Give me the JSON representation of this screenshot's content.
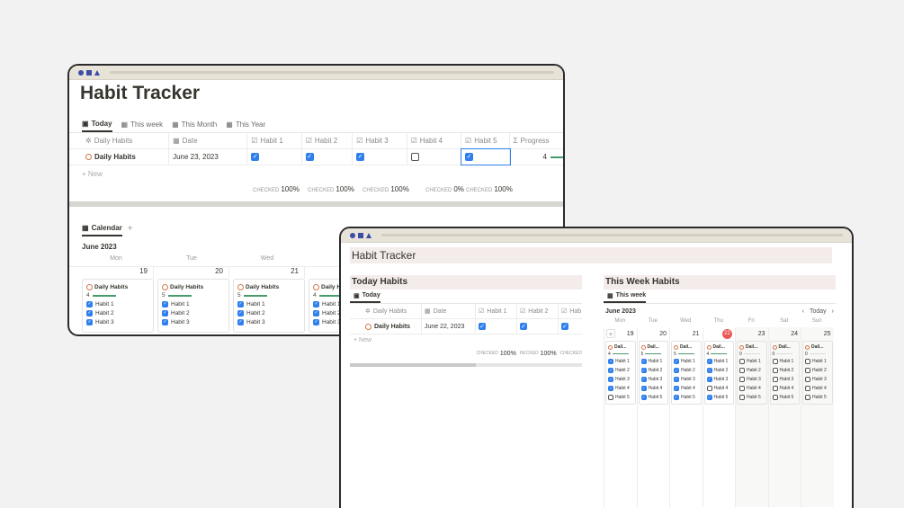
{
  "back": {
    "title": "Habit Tracker",
    "tabs": [
      "Today",
      "This week",
      "This Month",
      "This Year"
    ],
    "columns": [
      "Daily Habits",
      "Date",
      "Habit 1",
      "Habit 2",
      "Habit 3",
      "Habit 4",
      "Habit 5",
      "Progress"
    ],
    "row": {
      "name": "Daily Habits",
      "date": "June 23, 2023",
      "checks": [
        true,
        true,
        true,
        false,
        true
      ],
      "progress": "4"
    },
    "new_label": "+ New",
    "calc": [
      {
        "label": "CHECKED",
        "value": "100%"
      },
      {
        "label": "CHECKED",
        "value": "100%"
      },
      {
        "label": "CHECKED",
        "value": "100%"
      },
      {
        "label": "CHECKED",
        "value": "0%"
      },
      {
        "label": "CHECKED",
        "value": "100%"
      }
    ],
    "calendar": {
      "tab": "Calendar",
      "add": "+",
      "month": "June 2023",
      "dows": [
        "Mon",
        "Tue",
        "Wed"
      ],
      "days": [
        "19",
        "20",
        "21"
      ],
      "cards": [
        {
          "title": "Daily Habits",
          "progress": "4",
          "habits": [
            "Habit 1",
            "Habit 2",
            "Habit 3"
          ]
        },
        {
          "title": "Daily Habits",
          "progress": "5",
          "habits": [
            "Habit 1",
            "Habit 2",
            "Habit 3"
          ]
        },
        {
          "title": "Daily Habits",
          "progress": "5",
          "habits": [
            "Habit 1",
            "Habit 2",
            "Habit 3"
          ]
        },
        {
          "title": "Daily Habits",
          "progress": "4",
          "habits": [
            "Habit 1",
            "Habit 2",
            "Habit 3"
          ]
        }
      ]
    }
  },
  "front": {
    "title": "Habit Tracker",
    "today": {
      "title": "Today Habits",
      "tab": "Today",
      "columns": [
        "Daily Habits",
        "Date",
        "Habit 1",
        "Habit 2",
        "Hab"
      ],
      "row": {
        "name": "Daily Habits",
        "date": "June 22, 2023"
      },
      "new_label": "+ New",
      "calc": [
        {
          "label": "CHECKED",
          "value": "100%"
        },
        {
          "label": "HECKED",
          "value": "100%"
        },
        {
          "label": "CHECKED",
          "value": ""
        }
      ]
    },
    "week": {
      "title": "This Week Habits",
      "tab": "This week",
      "month": "June 2023",
      "today_btn": "Today",
      "prev": "‹",
      "next": "›",
      "dows": [
        "Mon",
        "Tue",
        "Wed",
        "Thu",
        "Fri",
        "Sat",
        "Sun"
      ],
      "days": [
        "19",
        "20",
        "21",
        "22",
        "23",
        "24",
        "25"
      ],
      "card_title": "Dail...",
      "progress": [
        "4",
        "5",
        "5",
        "4",
        "0",
        "0",
        "0"
      ],
      "habits": [
        "Habit 1",
        "Habit 2",
        "Habit 3",
        "Habit 4",
        "Habit 5"
      ],
      "checked": [
        [
          true,
          true,
          true,
          true,
          false
        ],
        [
          true,
          true,
          true,
          true,
          true
        ],
        [
          true,
          true,
          true,
          true,
          true
        ],
        [
          true,
          true,
          true,
          false,
          true
        ],
        [
          false,
          false,
          false,
          false,
          false
        ],
        [
          false,
          false,
          false,
          false,
          false
        ],
        [
          false,
          false,
          false,
          false,
          false
        ]
      ]
    }
  }
}
